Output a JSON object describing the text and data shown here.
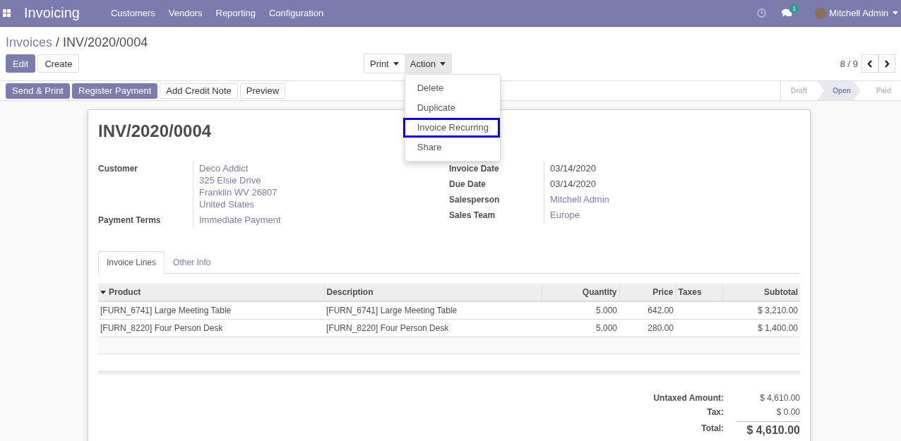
{
  "navbar": {
    "brand": "Invoicing",
    "menus": [
      "Customers",
      "Vendors",
      "Reporting",
      "Configuration"
    ],
    "message_count": "1",
    "user": "Mitchell Admin"
  },
  "breadcrumb": {
    "parent": "Invoices",
    "separator": "/",
    "current": "INV/2020/0004"
  },
  "main_buttons": [
    {
      "label": "Edit",
      "primary": true
    },
    {
      "label": "Create",
      "primary": false
    }
  ],
  "sidebar_buttons": [
    {
      "label": "Print",
      "open": false
    },
    {
      "label": "Action",
      "open": true
    }
  ],
  "action_menu": [
    {
      "label": "Delete",
      "selected": false
    },
    {
      "label": "Duplicate",
      "selected": false
    },
    {
      "label": "Invoice Recurring",
      "selected": true
    },
    {
      "label": "Share",
      "selected": false
    }
  ],
  "pager": "8 / 9",
  "header_buttons": [
    {
      "label": "Send & Print",
      "primary": true
    },
    {
      "label": "Register Payment",
      "primary": true
    },
    {
      "label": "Add Credit Note",
      "primary": false
    },
    {
      "label": "Preview",
      "primary": false
    }
  ],
  "statuses": [
    {
      "label": "Draft",
      "selected": false
    },
    {
      "label": "Open",
      "selected": true
    },
    {
      "label": "Paid",
      "selected": false
    }
  ],
  "title": "INV/2020/0004",
  "left_fields": [
    {
      "label": "Customer",
      "link": true,
      "values": [
        "Deco Addict",
        "325 Elsie Drive",
        "Franklin WV 26807",
        "United States"
      ]
    },
    {
      "label": "Payment Terms",
      "link": true,
      "values": [
        "Immediate Payment"
      ]
    }
  ],
  "right_fields": [
    {
      "label": "Invoice Date",
      "link": false,
      "values": [
        "03/14/2020"
      ]
    },
    {
      "label": "Due Date",
      "link": false,
      "values": [
        "03/14/2020"
      ]
    },
    {
      "label": "Salesperson",
      "link": true,
      "values": [
        "Mitchell Admin"
      ]
    },
    {
      "label": "Sales Team",
      "link": true,
      "values": [
        "Europe"
      ]
    }
  ],
  "tabs": [
    {
      "label": "Invoice Lines",
      "selected": true
    },
    {
      "label": "Other Info",
      "selected": false
    }
  ],
  "table": {
    "columns": [
      {
        "label": "Product",
        "kind": "text"
      },
      {
        "label": "Description",
        "kind": "text"
      },
      {
        "label": "Quantity",
        "kind": "number"
      },
      {
        "label": "Price",
        "kind": "number"
      },
      {
        "label": "Taxes",
        "kind": "text"
      },
      {
        "label": "Subtotal",
        "kind": "number"
      }
    ],
    "rows": [
      [
        "[FURN_6741] Large Meeting Table",
        "[FURN_6741] Large Meeting Table",
        "5.000",
        "642.00",
        "",
        "$ 3,210.00"
      ],
      [
        "[FURN_8220] Four Person Desk",
        "[FURN_8220] Four Person Desk",
        "5.000",
        "280.00",
        "",
        "$ 1,400.00"
      ]
    ]
  },
  "totals": [
    {
      "label": "Untaxed Amount:",
      "value": "$ 4,610.00",
      "kind": "line"
    },
    {
      "label": "Tax:",
      "value": "$ 0.00",
      "kind": "line"
    },
    {
      "label": "Total:",
      "value": "$ 4,610.00",
      "kind": "total"
    }
  ]
}
